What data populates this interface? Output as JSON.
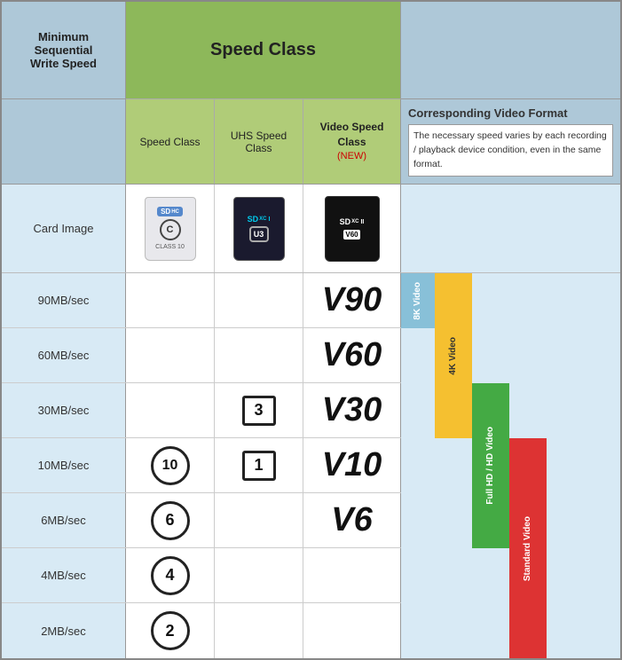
{
  "header": {
    "min_write_label": "Minimum\nSequential\nWrite Speed",
    "speed_class_header": "Speed Class",
    "speed_class_sub": "Speed Class",
    "uhs_speed_sub": "UHS Speed Class",
    "video_speed_sub": "Video Speed Class",
    "video_speed_new": "(NEW)",
    "corresponding_title": "Corresponding Video Format",
    "corresponding_desc": "The necessary speed varies by each recording / playback device condition, even in the same format."
  },
  "rows": [
    {
      "speed": "90MB/sec",
      "sc": "",
      "uhs": "",
      "vs": "V90"
    },
    {
      "speed": "60MB/sec",
      "sc": "",
      "uhs": "",
      "vs": "V60"
    },
    {
      "speed": "30MB/sec",
      "sc": "",
      "uhs": "U3",
      "vs": "V30"
    },
    {
      "speed": "10MB/sec",
      "sc": "C10",
      "uhs": "U1",
      "vs": "V10"
    },
    {
      "speed": "6MB/sec",
      "sc": "C6",
      "uhs": "",
      "vs": "V6"
    },
    {
      "speed": "4MB/sec",
      "sc": "C4",
      "uhs": "",
      "vs": ""
    },
    {
      "speed": "2MB/sec",
      "sc": "C2",
      "uhs": "",
      "vs": ""
    }
  ],
  "video_formats": [
    {
      "label": "8K Video",
      "color": "#88bbdd",
      "text_color": "white",
      "top_pct": 0,
      "height_pct": 37
    },
    {
      "label": "4K Video",
      "color": "#f5c030",
      "text_color": "#333",
      "top_pct": 22,
      "height_pct": 55
    },
    {
      "label": "Full HD / HD Video",
      "color": "#44aa44",
      "text_color": "white",
      "top_pct": 37,
      "height_pct": 50
    },
    {
      "label": "Standard Video",
      "color": "#dd3333",
      "text_color": "white",
      "top_pct": 56,
      "height_pct": 44
    }
  ],
  "card_label": "Card Image"
}
